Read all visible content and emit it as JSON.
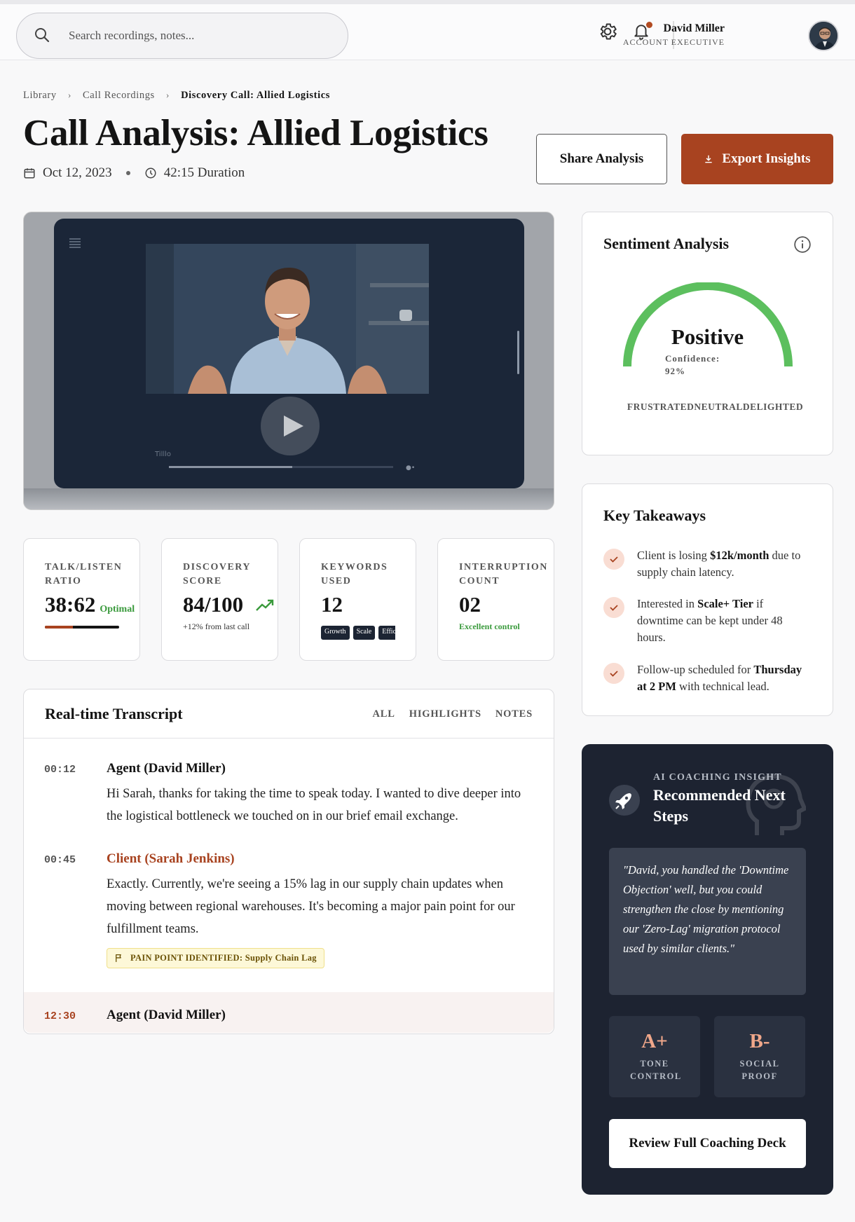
{
  "topbar": {
    "search_placeholder": "Search recordings, notes...",
    "user_name": "David Miller",
    "user_role": "ACCOUNT EXECUTIVE",
    "notification_indicator_color": "#b24b22"
  },
  "breadcrumb": {
    "items": [
      "Library",
      "Call Recordings",
      "Discovery Call: Allied Logistics"
    ]
  },
  "header": {
    "title": "Call Analysis: Allied Logistics",
    "date": "Oct 12, 2023",
    "duration": "42:15 Duration",
    "share_label": "Share Analysis",
    "export_label": "Export Insights",
    "accent_color": "#a84320"
  },
  "video": {
    "brand_text": "Tilllo",
    "progress": 0.55
  },
  "stats": [
    {
      "label": "TALK/LISTEN RATIO",
      "value": "38:62",
      "tag": "Optimal",
      "bar_fraction": 0.38
    },
    {
      "label": "DISCOVERY SCORE",
      "value": "84/100",
      "sub": "+12% from last call"
    },
    {
      "label": "KEYWORDS USED",
      "value": "12",
      "chips": [
        "Growth",
        "Scale",
        "Efficiency"
      ]
    },
    {
      "label": "INTERRUPTION COUNT",
      "value": "02",
      "sub": "Excellent control"
    }
  ],
  "transcript": {
    "title": "Real-time Transcript",
    "tabs": [
      "ALL",
      "HIGHLIGHTS",
      "NOTES"
    ],
    "entries": [
      {
        "time": "00:12",
        "speaker": "Agent (David Miller)",
        "text": "Hi Sarah, thanks for taking the time to speak today. I wanted to dive deeper into the logistical bottleneck we touched on in our brief email exchange."
      },
      {
        "time": "00:45",
        "speaker": "Client (Sarah Jenkins)",
        "text": "Exactly. Currently, we're seeing a 15% lag in our supply chain updates when moving between regional warehouses. It's becoming a major pain point for our fulfillment teams."
      },
      {
        "time": "12:30",
        "speaker": "Agent (David Miller)",
        "text": ""
      }
    ],
    "pain_point_tag": "PAIN POINT IDENTIFIED: Supply Chain Lag"
  },
  "sentiment": {
    "title": "Sentiment Analysis",
    "value": "Positive",
    "confidence_label": "Confidence:",
    "confidence_value": "92%",
    "confidence": 0.92,
    "scale_labels": "FRUSTRATEDNEUTRALDELIGHTED",
    "gauge_color": "#5cbf5e"
  },
  "takeaways": {
    "title": "Key Takeaways",
    "items": [
      {
        "pre": "Client is losing ",
        "bold": "$12k/month",
        "post": " due to supply chain latency."
      },
      {
        "pre": "Interested in ",
        "bold": "Scale+ Tier",
        "post": " if downtime can be kept under 48 hours."
      },
      {
        "pre": "Follow-up scheduled for ",
        "bold": "Thursday at 2 PM",
        "post": " with technical lead."
      }
    ]
  },
  "coaching": {
    "eyebrow": "AI COACHING INSIGHT",
    "title": "Recommended Next Steps",
    "quote": "\"David, you handled the 'Downtime Objection' well, but you could strengthen the close by mentioning our 'Zero-Lag' migration protocol used by similar clients.\"",
    "grades": [
      {
        "grade": "A+",
        "label": "TONE CONTROL"
      },
      {
        "grade": "B-",
        "label": "SOCIAL PROOF"
      }
    ],
    "review_label": "Review Full Coaching Deck",
    "grade_color": "#f0a78a"
  }
}
